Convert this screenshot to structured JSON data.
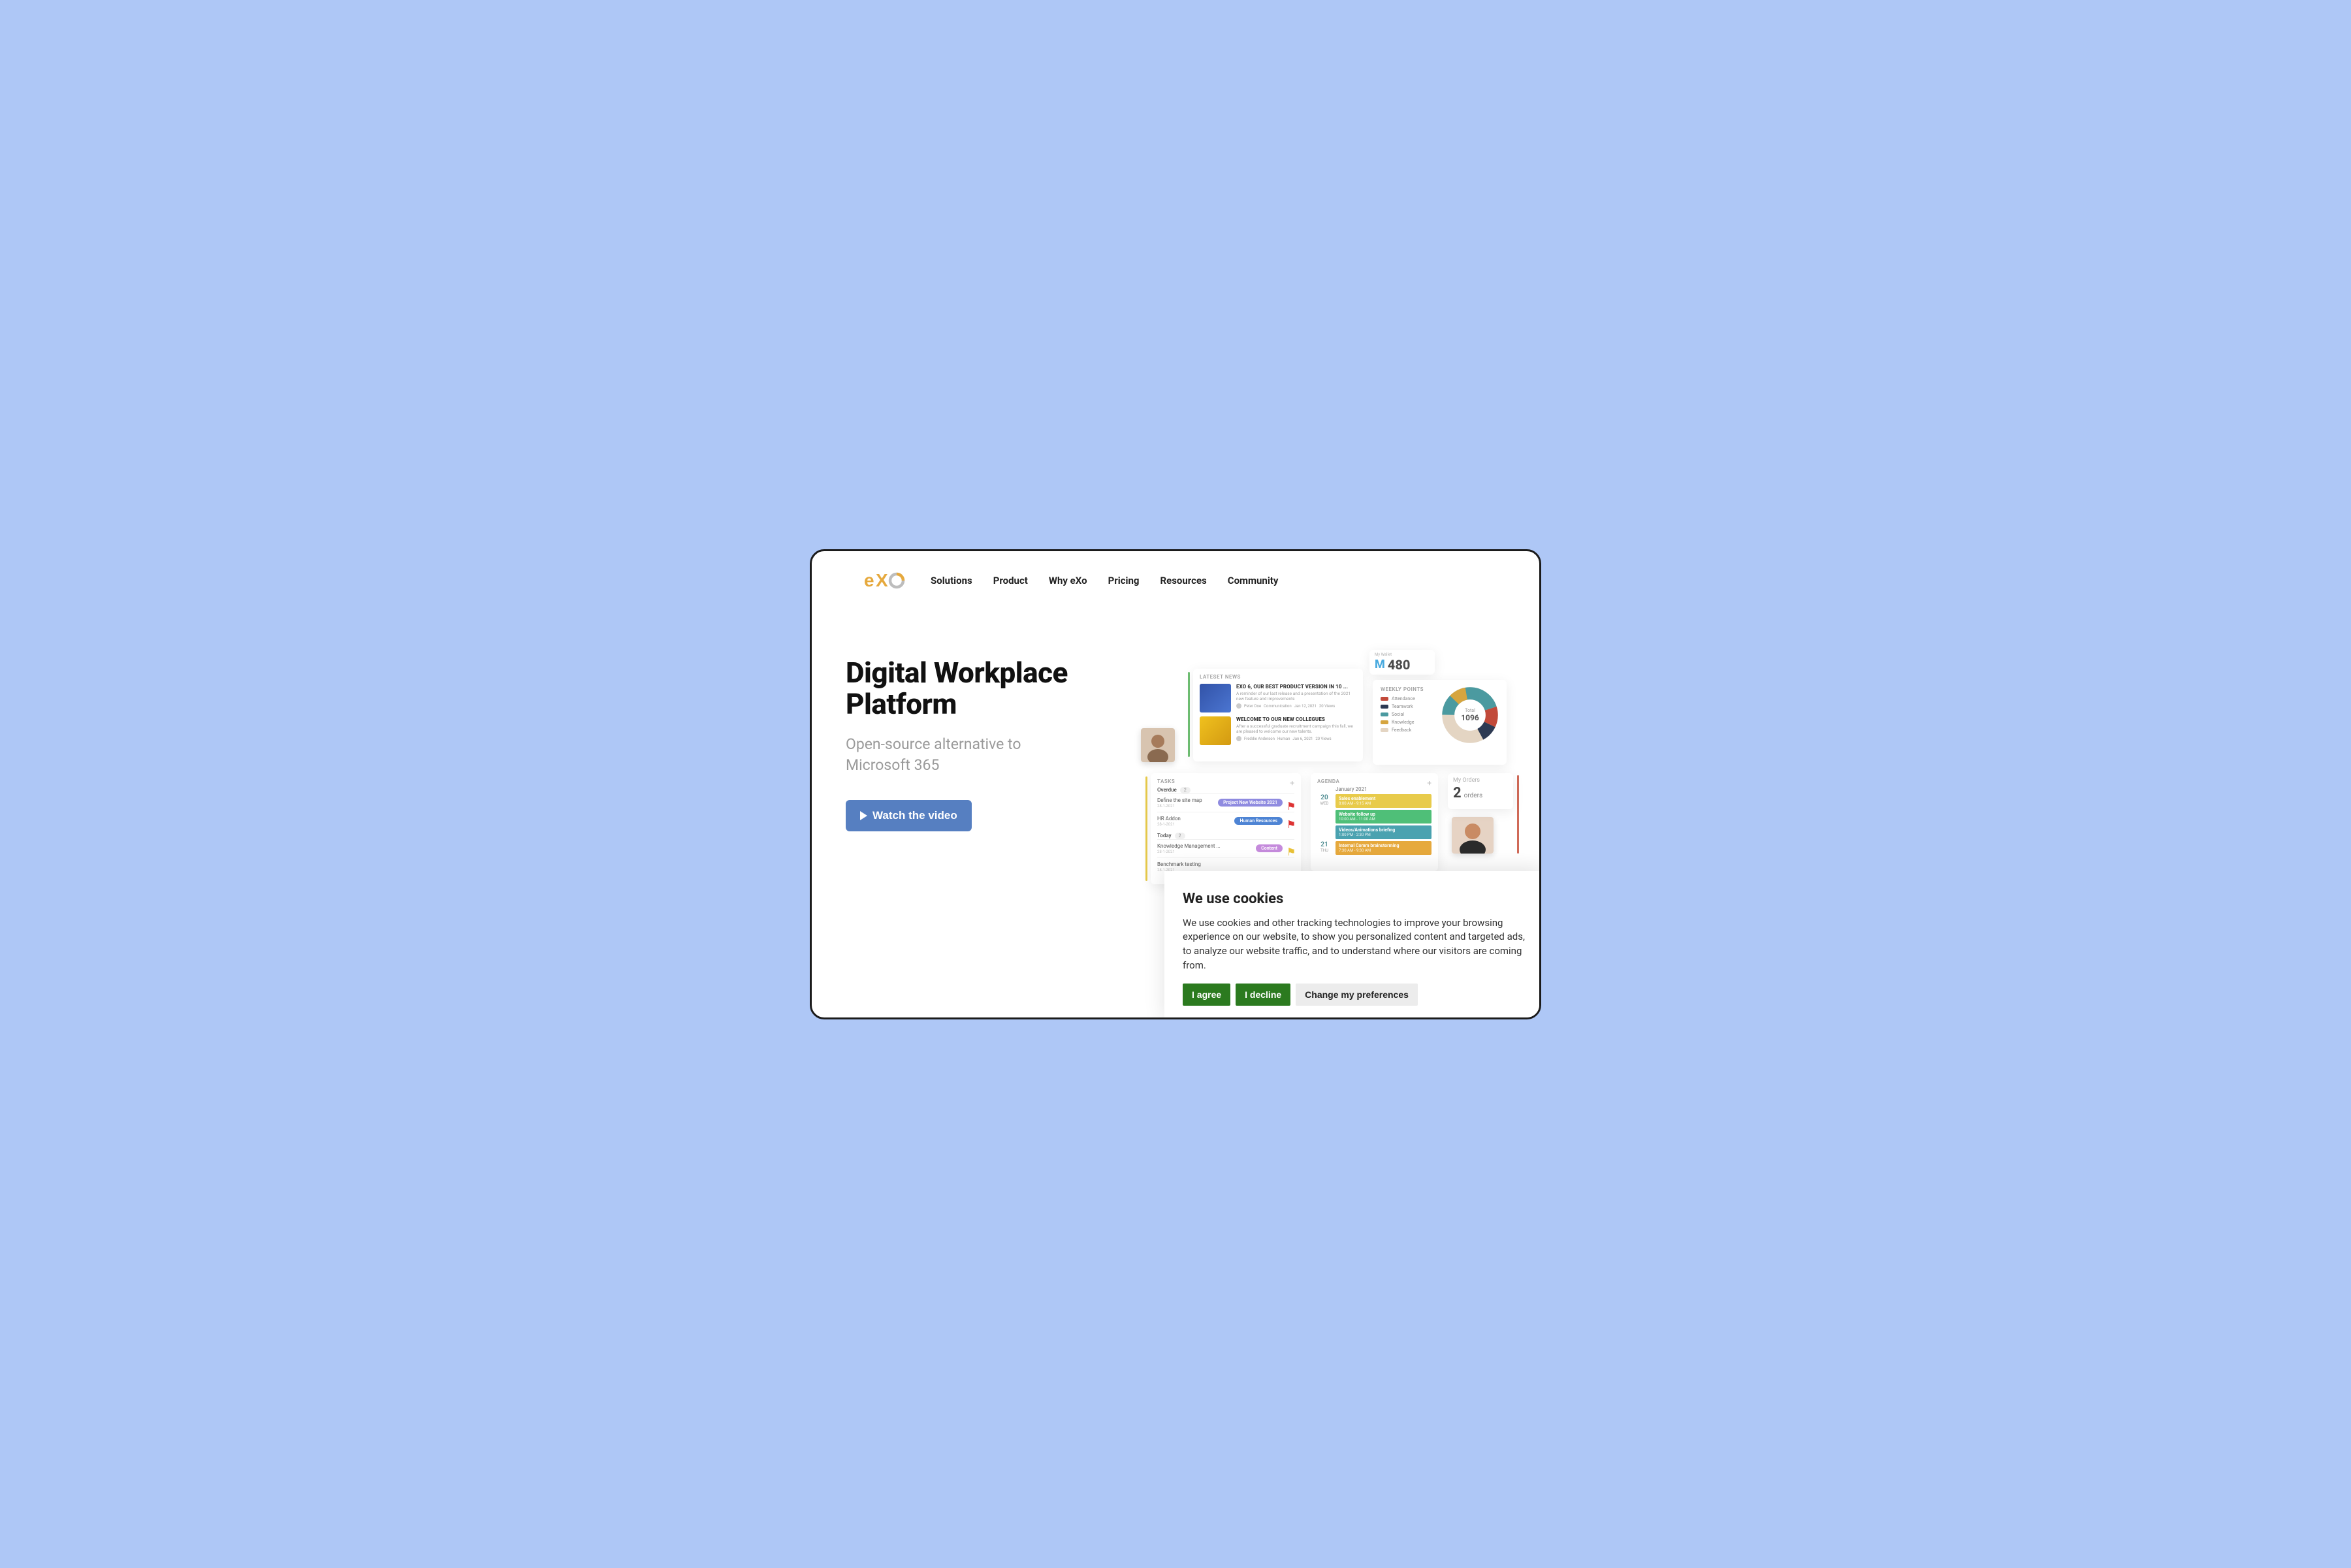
{
  "logo_text": "eXo",
  "nav": [
    "Solutions",
    "Product",
    "Why eXo",
    "Pricing",
    "Resources",
    "Community"
  ],
  "hero": {
    "title": "Digital Workplace Platform",
    "subtitle": "Open-source alternative to Microsoft 365",
    "watch_label": "Watch the video"
  },
  "wallet": {
    "label": "My Wallet",
    "symbol": "M",
    "value": "480"
  },
  "news": {
    "title": "LATESET NEWS",
    "items": [
      {
        "headline": "EXO 6, OUR BEST PRODUCT VERSION IN 10 ...",
        "body": "A reminder of our last release and a presentation of the 2021 new feature and improvements",
        "author": "Peter Doe",
        "tag": "Communication",
        "date": "Jan 12, 2021",
        "views": "20 Views"
      },
      {
        "headline": "WELCOME TO OUR NEW COLLEGUES",
        "body": "After a successful graduate recruitment campaign this fall, we are pleased to welcome our new talents.",
        "author": "Freddie Anderson",
        "tag": "Human",
        "date": "Jan 6, 2021",
        "views": "20 Views"
      }
    ]
  },
  "points": {
    "title": "WEEKLY POINTS",
    "total_label": "Total",
    "total_value": "1096",
    "legend": [
      {
        "label": "Attendance",
        "color": "#c24a3a"
      },
      {
        "label": "Teamwork",
        "color": "#2d3a53"
      },
      {
        "label": "Social",
        "color": "#4b9aa0"
      },
      {
        "label": "Knowledge",
        "color": "#d6a53f"
      },
      {
        "label": "Feedback",
        "color": "#e4d5c3"
      }
    ]
  },
  "tasks": {
    "title": "TASKS",
    "sections": [
      {
        "name": "Overdue",
        "count": "2",
        "items": [
          {
            "name": "Define the site map",
            "date": "28-1-2021",
            "pill": "Project New Website 2021",
            "pill_color": "#8f8be0",
            "flag": "red"
          },
          {
            "name": "HR Addon",
            "date": "28-1-2021",
            "pill": "Human Resources",
            "pill_color": "#4e84d4",
            "flag": "red"
          }
        ]
      },
      {
        "name": "Today",
        "count": "2",
        "items": [
          {
            "name": "Knowledge Management ...",
            "date": "28-1-2021",
            "pill": "Content",
            "pill_color": "#c58bdc",
            "flag": "yellow"
          },
          {
            "name": "Benchmark testing",
            "date": "28-1-2021",
            "pill": "",
            "pill_color": "",
            "flag": ""
          }
        ]
      }
    ]
  },
  "agenda": {
    "title": "AGENDA",
    "month": "January 2021",
    "days": [
      {
        "day": "20",
        "weekday": "WED",
        "events": [
          {
            "title": "Sales enablement",
            "time": "8:00 AM - 9:15 AM",
            "color": "#e8cb4b"
          },
          {
            "title": "Website follow up",
            "time": "10:00 AM - 11:00 AM",
            "color": "#4fbf78"
          },
          {
            "title": "Videos/Animations briefing",
            "time": "1:00 PM - 2:30 PM",
            "color": "#4aa2b0"
          }
        ]
      },
      {
        "day": "21",
        "weekday": "THU",
        "events": [
          {
            "title": "Internal Comm brainstorming",
            "time": "7:30 AM - 9:30 AM",
            "color": "#e6a93d"
          }
        ]
      }
    ]
  },
  "orders": {
    "label": "My Orders",
    "value": "2",
    "unit": "orders"
  },
  "cookie": {
    "title": "We use cookies",
    "text": "We use cookies and other tracking technologies to improve your browsing experience on our website, to show you personalized content and targeted ads, to analyze our website traffic, and to understand where our visitors are coming from.",
    "agree": "I agree",
    "decline": "I decline",
    "prefs": "Change my preferences"
  },
  "colors": {
    "accent_left_green": "#6fbf73",
    "accent_tasks_yellow": "#e8cb4b",
    "accent_right_red": "#d06a58"
  }
}
